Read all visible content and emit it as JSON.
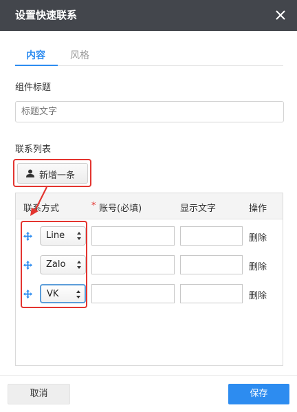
{
  "dialog": {
    "title": "设置快速联系"
  },
  "tabs": [
    {
      "label": "内容",
      "active": true
    },
    {
      "label": "风格",
      "active": false
    }
  ],
  "component_title": {
    "label": "组件标题",
    "placeholder": "标题文字"
  },
  "contact_list": {
    "label": "联系列表",
    "add_button": "新增一条",
    "columns": {
      "method": "联系方式",
      "required_mark": "*",
      "account": "账号(必填)",
      "display_text": "显示文字",
      "action": "操作"
    },
    "rows": [
      {
        "method": "Line",
        "account": "",
        "display_text": "",
        "action": "删除"
      },
      {
        "method": "Zalo",
        "account": "",
        "display_text": "",
        "action": "删除"
      },
      {
        "method": "VK",
        "account": "",
        "display_text": "",
        "action": "删除"
      }
    ]
  },
  "footer": {
    "cancel": "取消",
    "save": "保存"
  },
  "colors": {
    "header_bg": "#43464c",
    "accent": "#2d8cf0",
    "annotation_red": "#e3342f"
  }
}
